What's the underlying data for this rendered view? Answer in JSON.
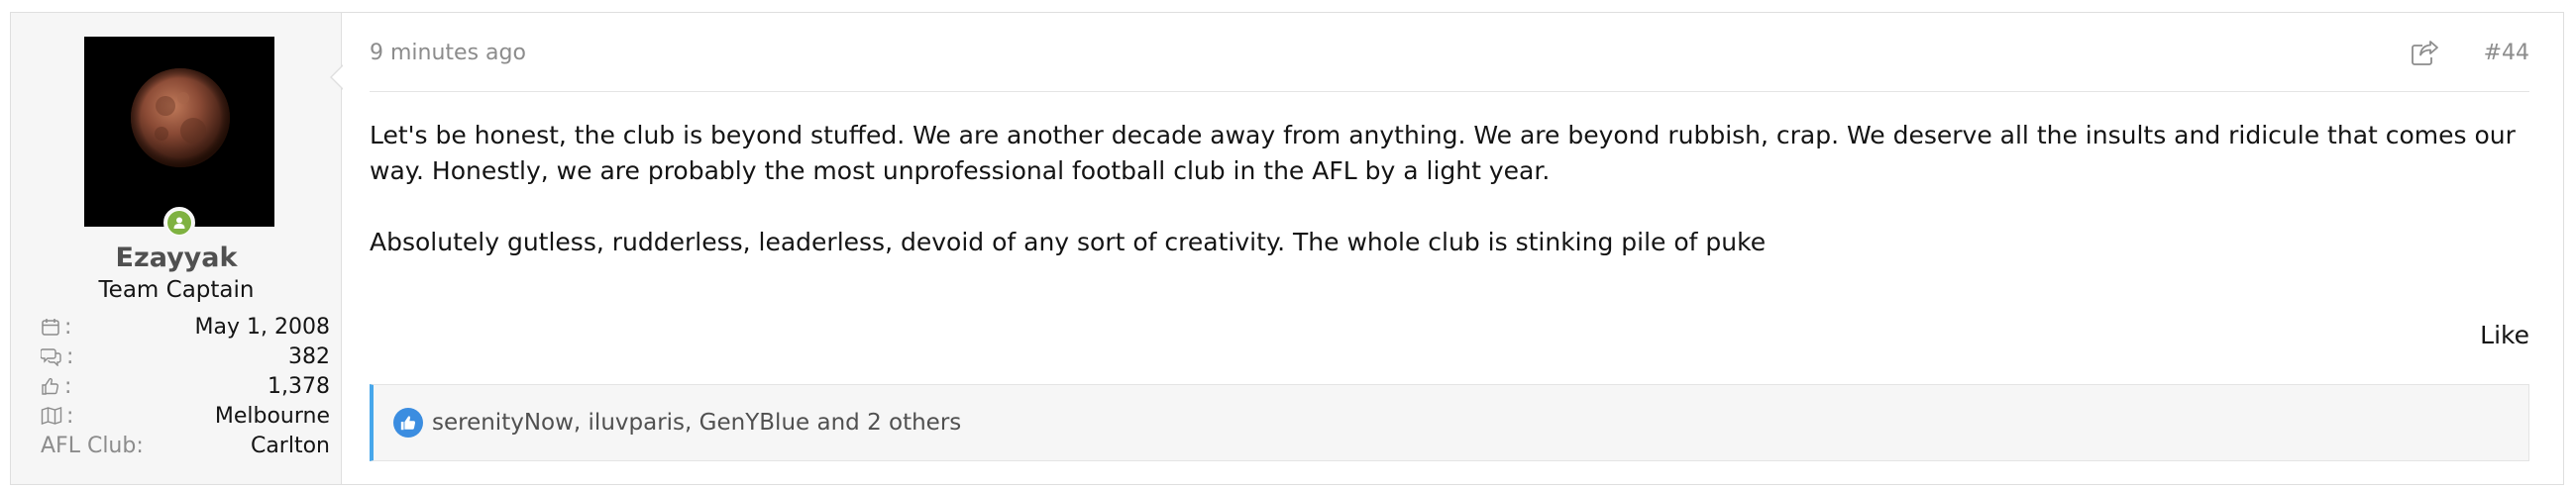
{
  "post": {
    "timestamp": "9 minutes ago",
    "post_number": "#44",
    "paragraphs": [
      "Let's be honest, the club is beyond stuffed. We are another decade away from anything. We are beyond rubbish, crap. We deserve all the insults and ridicule that comes our way. Honestly, we are probably the most unprofessional football club in the AFL by a light year.",
      "Absolutely gutless, rudderless, leaderless, devoid of any sort of creativity. The whole club is stinking pile of puke"
    ],
    "like_label": "Like"
  },
  "user": {
    "name": "Ezayyak",
    "title": "Team Captain",
    "status_color": "#7fb241",
    "stats": [
      {
        "icon": "calendar-icon",
        "value": "May 1, 2008"
      },
      {
        "icon": "messages-icon",
        "value": "382"
      },
      {
        "icon": "thumbs-up-icon",
        "value": "1,378"
      },
      {
        "icon": "map-icon",
        "value": "Melbourne"
      },
      {
        "label": "AFL Club:",
        "value": "Carlton"
      }
    ]
  },
  "reactions": {
    "users": [
      "serenityNow",
      "iluvparis",
      "GenYBlue"
    ],
    "sep1": ",",
    "sep2": ",",
    "others": "and 2 others",
    "accent_color": "#47a7eb"
  }
}
